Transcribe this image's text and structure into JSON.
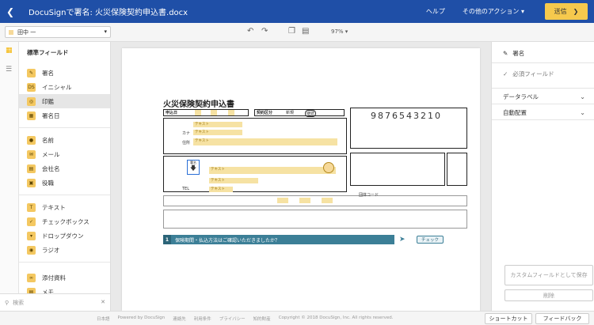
{
  "header": {
    "title": "DocuSignで署名: 火災保険契約申込書.docx",
    "help": "ヘルプ",
    "other_actions": "その他のアクション",
    "send": "送信"
  },
  "toolbar": {
    "recipient": "田中 一",
    "zoom": "97%"
  },
  "field_panel": {
    "title": "標準フィールド",
    "items": [
      {
        "label": "署名",
        "icon": "pen-icon"
      },
      {
        "label": "イニシャル",
        "icon": "initials-icon"
      },
      {
        "label": "印鑑",
        "icon": "seal-icon"
      },
      {
        "label": "署名日",
        "icon": "calendar-icon"
      },
      {
        "label": "名前",
        "icon": "person-icon"
      },
      {
        "label": "メール",
        "icon": "mail-icon"
      },
      {
        "label": "会社名",
        "icon": "building-icon"
      },
      {
        "label": "役職",
        "icon": "badge-icon"
      },
      {
        "label": "テキスト",
        "icon": "text-icon"
      },
      {
        "label": "チェックボックス",
        "icon": "checkbox-icon"
      },
      {
        "label": "ドロップダウン",
        "icon": "dropdown-icon"
      },
      {
        "label": "ラジオ",
        "icon": "radio-icon"
      },
      {
        "label": "添付資料",
        "icon": "paperclip-icon"
      },
      {
        "label": "メモ",
        "icon": "note-icon"
      }
    ],
    "active_index": 2,
    "search_placeholder": "検索"
  },
  "document": {
    "form_title": "火災保険契約申込書",
    "policy_number": "9876543210",
    "section_applicant": "申込日",
    "section_plan": "契約区分",
    "new": "新規",
    "renew": "継続",
    "field_text": "テキスト",
    "kana": "カナ",
    "address": "住所",
    "tel": "TEL",
    "sig_label": "署名",
    "group_code": "団体コード",
    "confirm_num": "1",
    "confirm_text": "保険期間・払込方法はご確認いただきましたか？",
    "check": "チェック"
  },
  "right_panel": {
    "signature": "署名",
    "required": "必須フィールド",
    "data_label": "データラベル",
    "auto_place": "自動配置",
    "save_custom": "カスタムフィールドとして保存",
    "delete": "削除"
  },
  "footer": {
    "links": [
      "日本語",
      "Powered by DocuSign",
      "連絡先",
      "利用条件",
      "プライバシー",
      "知的財産",
      "Copyright © 2018 DocuSign, Inc. All rights reserved."
    ],
    "shortcut": "ショートカット",
    "feedback": "フィードバック"
  }
}
